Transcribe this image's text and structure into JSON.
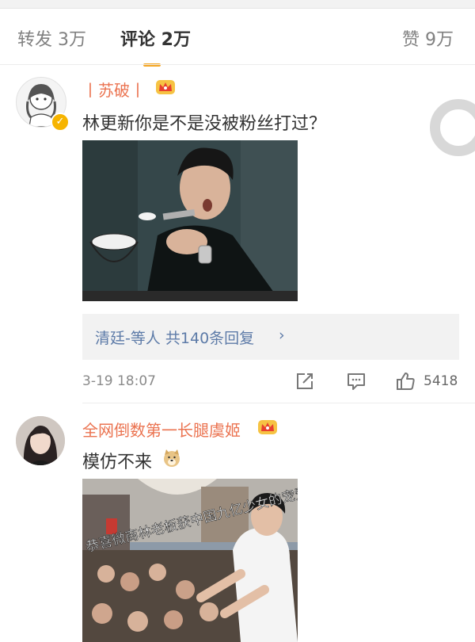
{
  "tabs": {
    "repost": "转发 3万",
    "comments": "评论 2万",
    "likes": "赞 9万"
  },
  "comments": [
    {
      "username": "丨苏破丨",
      "text": "林更新你是不是没被粉丝打过？",
      "reply_summary": "清廷-等人 共140条回复",
      "reply_chevron": "›",
      "timestamp": "3-19 18:07",
      "like_count": "5418"
    },
    {
      "username": "全网倒数第一长腿虞姬",
      "text": "模仿不来",
      "photo_caption": "恭喜微商林老板获中国九亿少女的宠爱"
    }
  ],
  "icons": [
    "crown-icon",
    "verified-icon",
    "repost-icon",
    "comment-icon",
    "like-icon"
  ],
  "colors": {
    "username": "#eb7350",
    "tab_underline": "#f5a623",
    "link": "#5d7ba8"
  }
}
